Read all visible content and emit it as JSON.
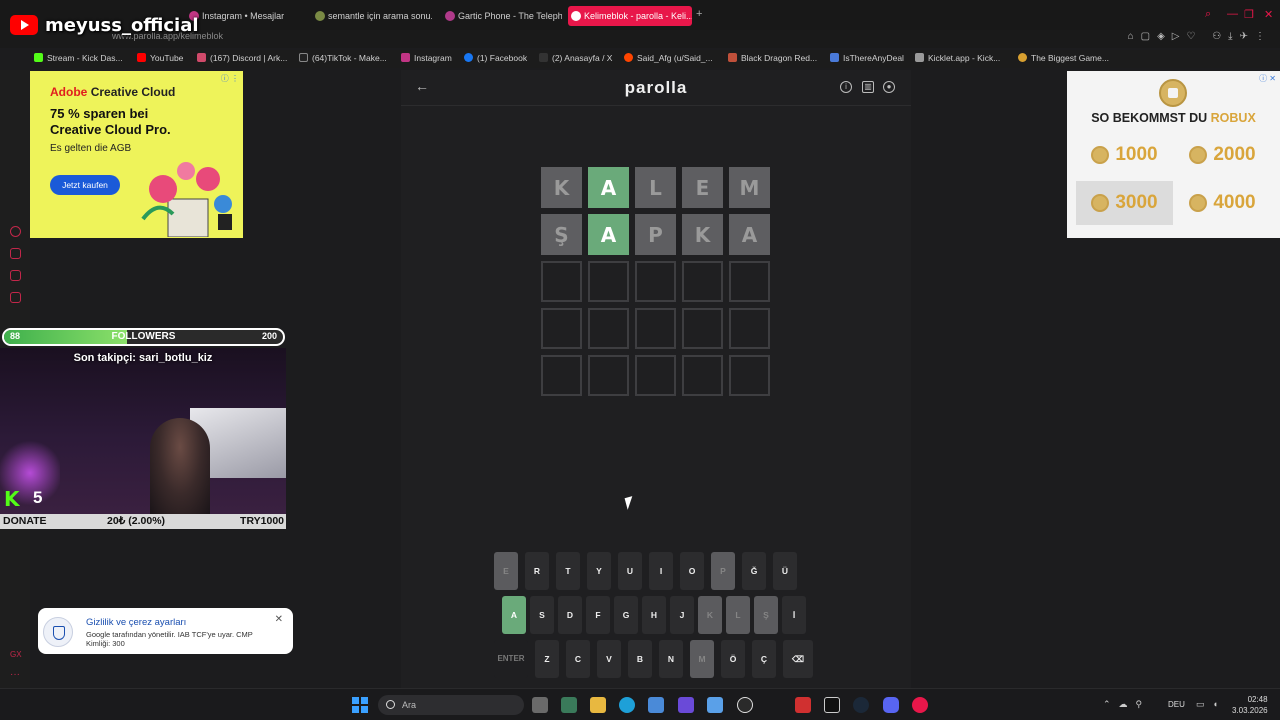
{
  "browser": {
    "tabs": [
      {
        "label": "Instagram • Mesajlar",
        "active": false
      },
      {
        "label": "semantle için arama sonu...",
        "active": false
      },
      {
        "label": "Gartic Phone - The Teleph...",
        "active": false
      },
      {
        "label": "Kelimeblok - parolla - Keli...",
        "active": true
      }
    ],
    "url": "www.parolla.app/kelimeblok",
    "bookmarks": [
      "Stream - Kick Das...",
      "YouTube",
      "(167) Discord | Ark...",
      "(64)TikTok - Make...",
      "Instagram",
      "(1) Facebook",
      "(2) Anasayfa / X",
      "Said_Afg (u/Said_...",
      "Black Dragon Red...",
      "IsThereAnyDeal",
      "Kicklet.app - Kick...",
      "The Biggest Game..."
    ]
  },
  "stream_overlay": {
    "channel": "meyuss_official",
    "followers_label": "FOLLOWERS",
    "followers_current": "88",
    "followers_goal": "200",
    "followers_fraction": 0.44,
    "last_follower": "Son takipçi: sari_botlu_kiz",
    "kick_count": "5",
    "donate_label": "DONATE",
    "donate_progress": "20₺ (2.00%)",
    "donate_goal": "TRY1000"
  },
  "ads": {
    "left": {
      "brand_a": "Adobe",
      "brand_b": "Creative Cloud",
      "headline": "75 % sparen bei Creative Cloud Pro.",
      "sub": "Es gelten die AGB",
      "cta": "Jetzt kaufen"
    },
    "right": {
      "title_a": "SO BEKOMMST DU",
      "title_b": "ROBUX",
      "amounts": [
        "1000",
        "2000",
        "3000",
        "4000"
      ]
    }
  },
  "consent": {
    "title": "Gizlilik ve çerez ayarları",
    "desc": "Google tarafından yönetilir. IAB TCF'ye uyar. CMP Kimliği: 300"
  },
  "game": {
    "title": "parolla",
    "rows": [
      [
        {
          "l": "K",
          "s": "absent"
        },
        {
          "l": "A",
          "s": "correct"
        },
        {
          "l": "L",
          "s": "absent"
        },
        {
          "l": "E",
          "s": "absent"
        },
        {
          "l": "M",
          "s": "absent"
        }
      ],
      [
        {
          "l": "Ş",
          "s": "absent"
        },
        {
          "l": "A",
          "s": "correct"
        },
        {
          "l": "P",
          "s": "absent"
        },
        {
          "l": "K",
          "s": "absent"
        },
        {
          "l": "A",
          "s": "absent"
        }
      ],
      [
        {
          "l": "",
          "s": "empty"
        },
        {
          "l": "",
          "s": "empty"
        },
        {
          "l": "",
          "s": "empty"
        },
        {
          "l": "",
          "s": "empty"
        },
        {
          "l": "",
          "s": "empty"
        }
      ],
      [
        {
          "l": "",
          "s": "empty"
        },
        {
          "l": "",
          "s": "empty"
        },
        {
          "l": "",
          "s": "empty"
        },
        {
          "l": "",
          "s": "empty"
        },
        {
          "l": "",
          "s": "empty"
        }
      ],
      [
        {
          "l": "",
          "s": "empty"
        },
        {
          "l": "",
          "s": "empty"
        },
        {
          "l": "",
          "s": "empty"
        },
        {
          "l": "",
          "s": "empty"
        },
        {
          "l": "",
          "s": "empty"
        }
      ]
    ],
    "keyboard": [
      [
        {
          "k": "E",
          "s": "absent"
        },
        {
          "k": "R"
        },
        {
          "k": "T"
        },
        {
          "k": "Y"
        },
        {
          "k": "U"
        },
        {
          "k": "I"
        },
        {
          "k": "O"
        },
        {
          "k": "P",
          "s": "absent"
        },
        {
          "k": "Ğ"
        },
        {
          "k": "Ü"
        }
      ],
      [
        {
          "k": "A",
          "s": "correct"
        },
        {
          "k": "S"
        },
        {
          "k": "D"
        },
        {
          "k": "F"
        },
        {
          "k": "G"
        },
        {
          "k": "H"
        },
        {
          "k": "J"
        },
        {
          "k": "K",
          "s": "absent"
        },
        {
          "k": "L",
          "s": "absent"
        },
        {
          "k": "Ş",
          "s": "absent"
        },
        {
          "k": "İ"
        }
      ],
      [
        {
          "k": "ENTER",
          "s": "special"
        },
        {
          "k": "Z"
        },
        {
          "k": "C"
        },
        {
          "k": "V"
        },
        {
          "k": "B"
        },
        {
          "k": "N"
        },
        {
          "k": "M",
          "s": "absent"
        },
        {
          "k": "Ö"
        },
        {
          "k": "Ç"
        },
        {
          "k": "⌫"
        }
      ]
    ]
  },
  "taskbar": {
    "search": "Ara",
    "lang": "DEU",
    "time": "02:48",
    "date": "3.03.2026"
  }
}
